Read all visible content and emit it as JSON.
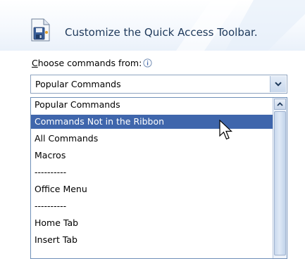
{
  "header": {
    "title": "Customize the Quick Access Toolbar."
  },
  "commands": {
    "label_accesskey": "C",
    "label_rest": "hoose commands from:",
    "selected_value": "Popular Commands"
  },
  "dropdown": {
    "items": [
      "Popular Commands",
      "Commands Not in the Ribbon",
      "All Commands",
      "Macros",
      "----------",
      "Office Menu",
      "----------",
      "Home Tab",
      "Insert Tab"
    ],
    "highlighted_index": 1
  },
  "icons": {
    "header": "quick-access-toolbar-icon",
    "info": "info-icon",
    "combo_arrow": "chevron-down-icon",
    "scroll_up": "scroll-up-arrow-icon",
    "cursor": "mouse-pointer-icon"
  },
  "colors": {
    "title": "#1e395b",
    "selection": "#3f66ac",
    "border": "#8ea3c0"
  }
}
